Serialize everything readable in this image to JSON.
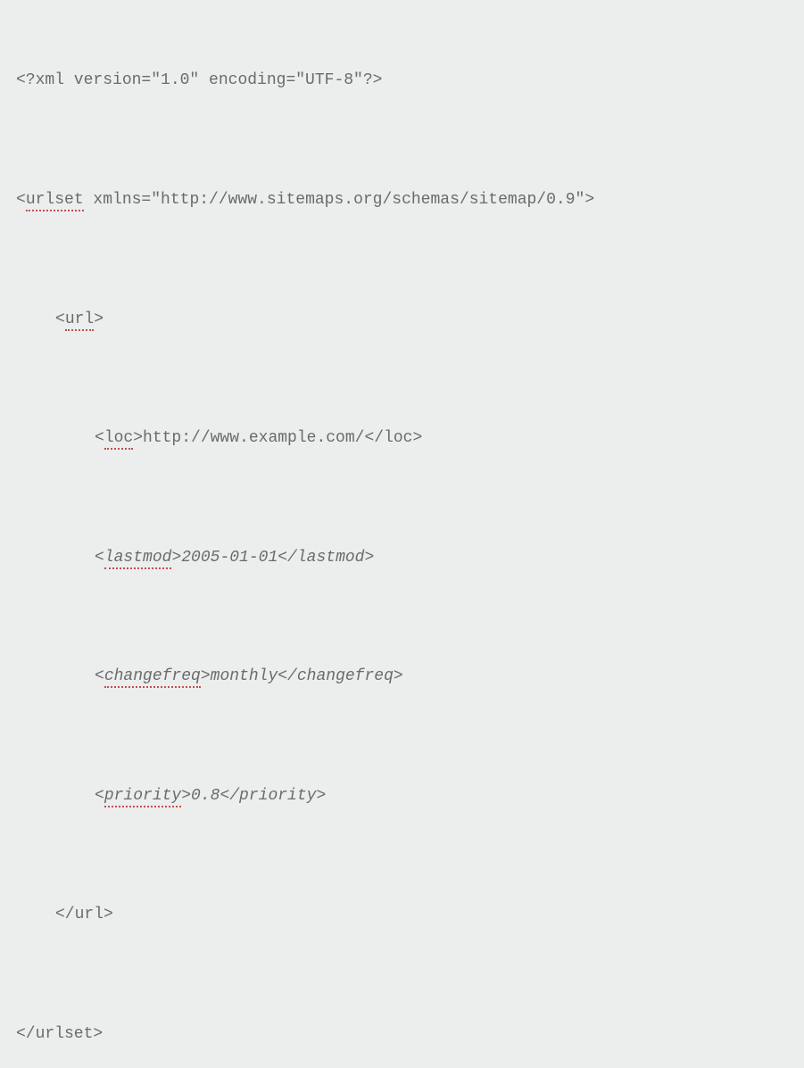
{
  "lines": {
    "l1_pre": "<?xml version=\"1.0\" encoding=\"UTF-8\"?>",
    "l2_pre": "<",
    "l2_tag": "urlset",
    "l2_post": " xmlns=\"http://www.sitemaps.org/schemas/sitemap/0.9\">",
    "l3_pre": "<",
    "l3_tag": "url",
    "l3_post": ">",
    "l4_pre": "<",
    "l4_tag": "loc",
    "l4_post": ">http://www.example.com/</loc>",
    "l5_pre": "<",
    "l5_tag": "lastmod",
    "l5_post": ">2005-01-01</lastmod>",
    "l6_pre": "<",
    "l6_tag": "changefreq",
    "l6_post": ">monthly</changefreq>",
    "l7_pre": "<",
    "l7_tag": "priority",
    "l7_post": ">0.8</priority>",
    "l8": "</url>",
    "l9": "</urlset>"
  }
}
